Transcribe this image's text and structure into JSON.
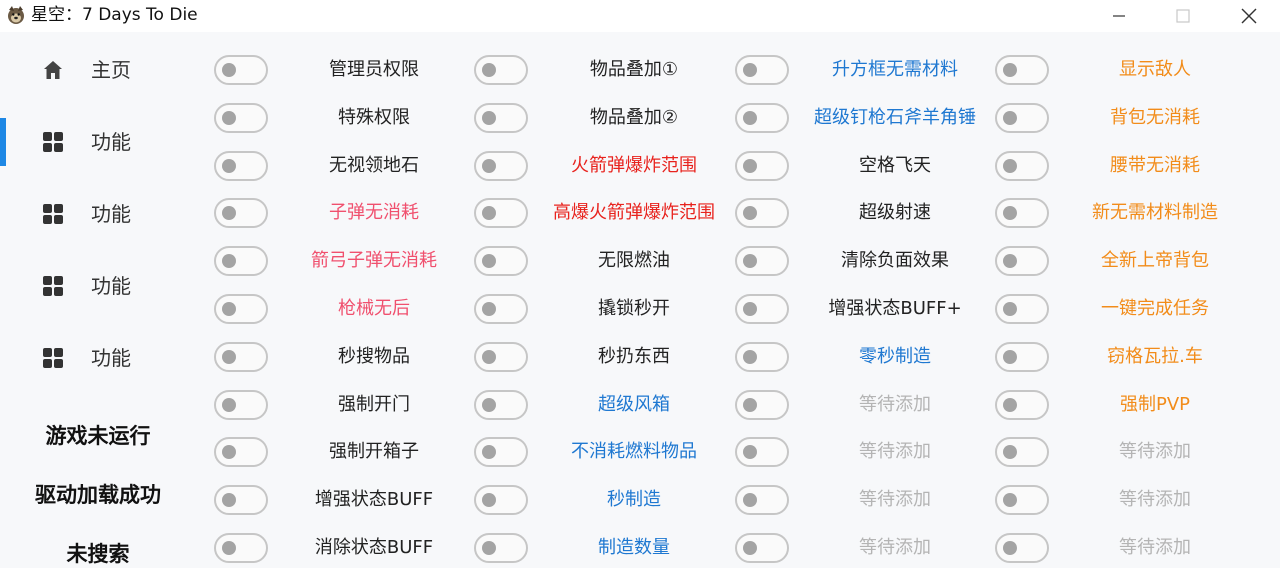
{
  "window": {
    "title": "星空：7 Days To Die",
    "app_icon": "dog-logo-icon"
  },
  "sidebar": {
    "items": [
      {
        "label": "主页",
        "icon": "home-icon",
        "active": false
      },
      {
        "label": "功能",
        "icon": "grid-icon",
        "active": true
      },
      {
        "label": "功能",
        "icon": "grid-icon",
        "active": false
      },
      {
        "label": "功能",
        "icon": "grid-icon",
        "active": false
      },
      {
        "label": "功能",
        "icon": "grid-icon",
        "active": false
      }
    ],
    "status": {
      "game": "游戏未运行",
      "driver": "驱动加载成功",
      "search": "未搜索"
    }
  },
  "colors": {
    "accent": "#1e88e5",
    "black": "#222222",
    "red": "#e8231e",
    "pink": "#f0506e",
    "blue": "#1f78d1",
    "orange": "#f28c1a",
    "gray": "#b4b4b4"
  },
  "features": {
    "columns": [
      [
        {
          "label": "管理员权限",
          "color": "black"
        },
        {
          "label": "特殊权限",
          "color": "black"
        },
        {
          "label": "无视领地石",
          "color": "black"
        },
        {
          "label": "子弹无消耗",
          "color": "pink"
        },
        {
          "label": "箭弓子弹无消耗",
          "color": "pink"
        },
        {
          "label": "枪械无后",
          "color": "pink"
        },
        {
          "label": "秒搜物品",
          "color": "black"
        },
        {
          "label": "强制开门",
          "color": "black"
        },
        {
          "label": "强制开箱子",
          "color": "black"
        },
        {
          "label": "增强状态BUFF",
          "color": "black"
        },
        {
          "label": "消除状态BUFF",
          "color": "black"
        }
      ],
      [
        {
          "label": "物品叠加①",
          "color": "black"
        },
        {
          "label": "物品叠加②",
          "color": "black"
        },
        {
          "label": "火箭弹爆炸范围",
          "color": "red"
        },
        {
          "label": "高爆火箭弹爆炸范围",
          "color": "red"
        },
        {
          "label": "无限燃油",
          "color": "black"
        },
        {
          "label": "撬锁秒开",
          "color": "black"
        },
        {
          "label": "秒扔东西",
          "color": "black"
        },
        {
          "label": "超级风箱",
          "color": "blue"
        },
        {
          "label": "不消耗燃料物品",
          "color": "blue"
        },
        {
          "label": "秒制造",
          "color": "blue"
        },
        {
          "label": "制造数量",
          "color": "blue"
        }
      ],
      [
        {
          "label": "升方框无需材料",
          "color": "blue"
        },
        {
          "label": "超级钉枪石斧羊角锤",
          "color": "blue"
        },
        {
          "label": "空格飞天",
          "color": "black"
        },
        {
          "label": "超级射速",
          "color": "black"
        },
        {
          "label": "清除负面效果",
          "color": "black"
        },
        {
          "label": "增强状态BUFF+",
          "color": "black"
        },
        {
          "label": "零秒制造",
          "color": "blue"
        },
        {
          "label": "等待添加",
          "color": "gray"
        },
        {
          "label": "等待添加",
          "color": "gray"
        },
        {
          "label": "等待添加",
          "color": "gray"
        },
        {
          "label": "等待添加",
          "color": "gray"
        }
      ],
      [
        {
          "label": "显示敌人",
          "color": "orange"
        },
        {
          "label": "背包无消耗",
          "color": "orange"
        },
        {
          "label": "腰带无消耗",
          "color": "orange"
        },
        {
          "label": "新无需材料制造",
          "color": "orange"
        },
        {
          "label": "全新上帝背包",
          "color": "orange"
        },
        {
          "label": "一键完成任务",
          "color": "orange"
        },
        {
          "label": "窃格瓦拉.车",
          "color": "orange"
        },
        {
          "label": "强制PVP",
          "color": "orange"
        },
        {
          "label": "等待添加",
          "color": "gray"
        },
        {
          "label": "等待添加",
          "color": "gray"
        },
        {
          "label": "等待添加",
          "color": "gray"
        }
      ]
    ]
  }
}
